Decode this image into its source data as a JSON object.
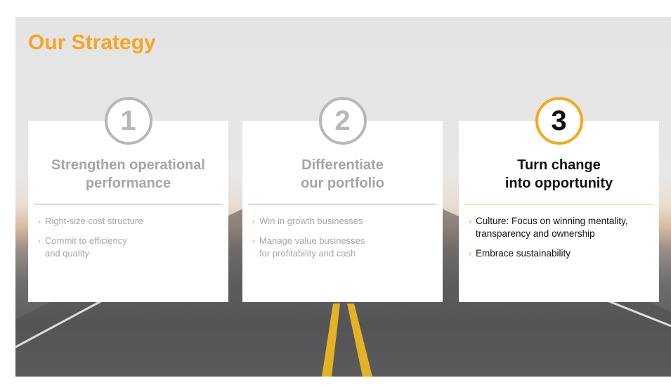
{
  "title": "Our Strategy",
  "accent_color": "#f5a623",
  "cards": [
    {
      "number": "1",
      "heading": [
        "Strengthen operational",
        "performance"
      ],
      "bullets": [
        [
          "Right-size cost structure"
        ],
        [
          "Commit to efficiency",
          "and quality"
        ]
      ]
    },
    {
      "number": "2",
      "heading": [
        "Differentiate",
        "our portfolio"
      ],
      "bullets": [
        [
          "Win in growth businesses"
        ],
        [
          "Manage value businesses",
          "for profitability and cash"
        ]
      ]
    },
    {
      "number": "3",
      "heading": [
        "Turn change",
        "into opportunity"
      ],
      "bullets": [
        [
          "Culture: Focus on winning mentality,",
          "transparency and ownership"
        ],
        [
          "Embrace sustainability"
        ]
      ]
    }
  ]
}
